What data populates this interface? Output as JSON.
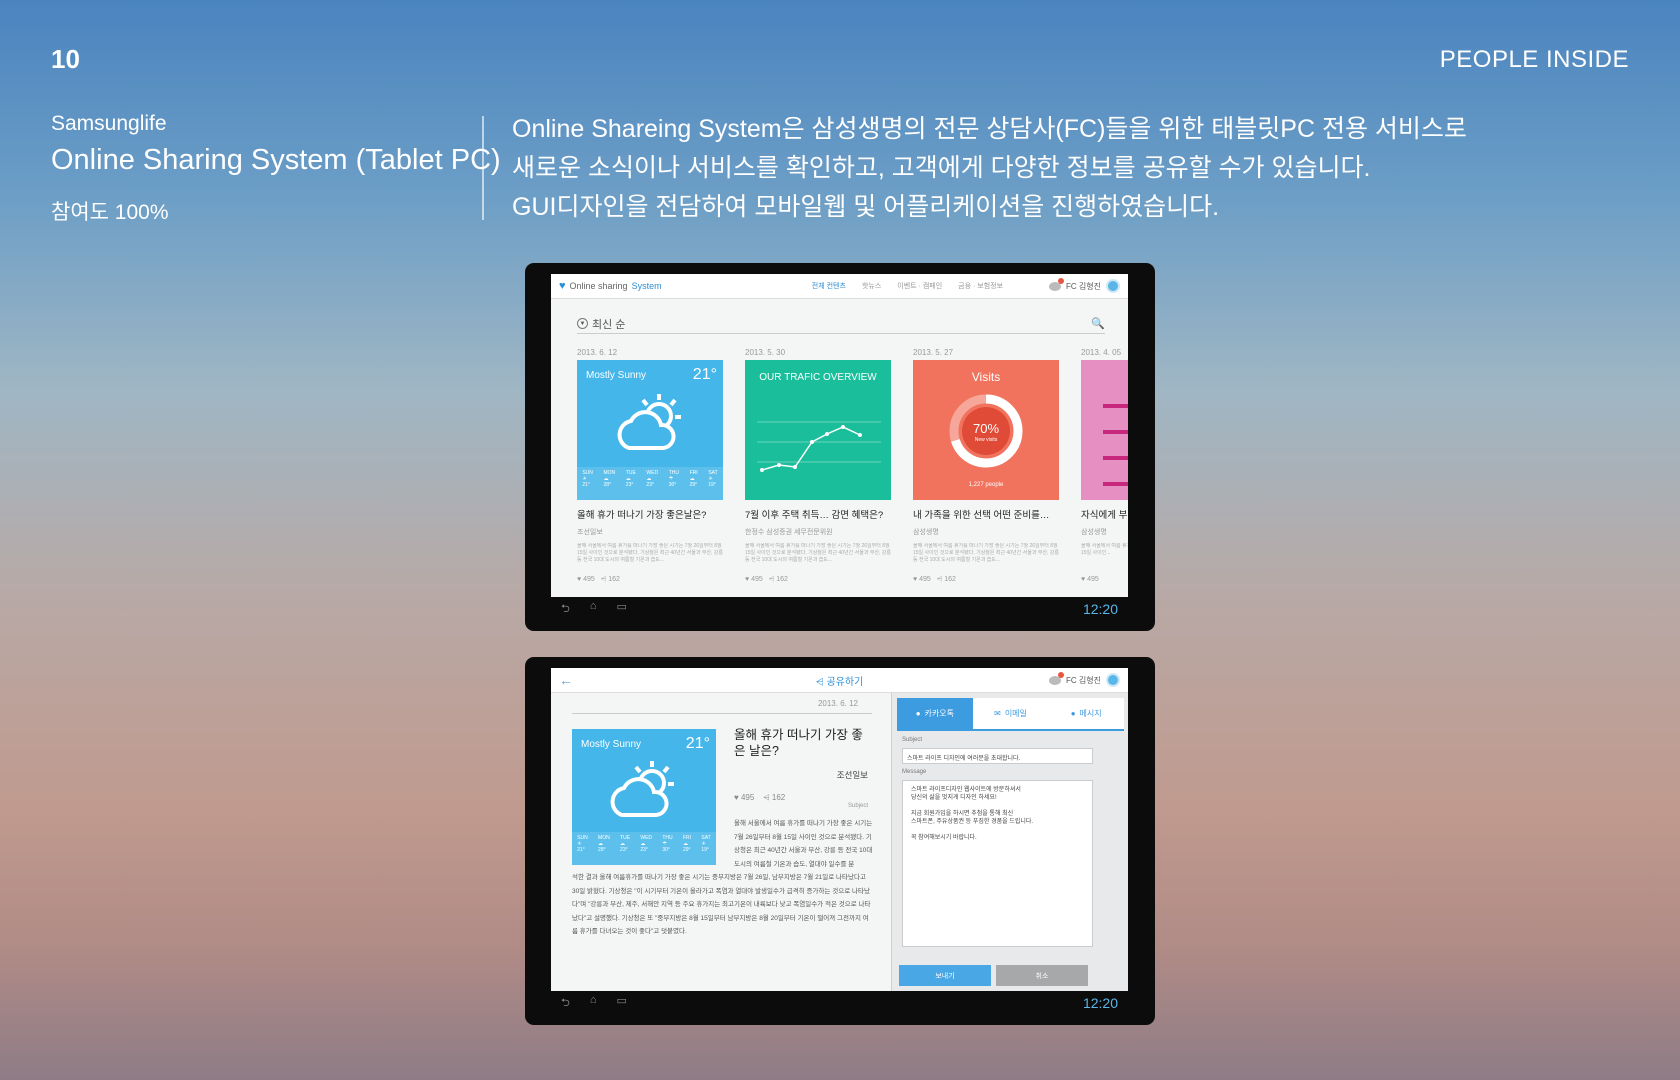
{
  "page_number": "10",
  "brand": "PEOPLE INSIDE",
  "project": {
    "company": "Samsunglife",
    "title": "Online Sharing System (Tablet PC)",
    "participation": "참여도 100%"
  },
  "description": [
    "Online Shareing System은 삼성생명의 전문 상담사(FC)들을 위한 태블릿PC 전용 서비스로",
    "새로운 소식이나 서비스를 확인하고, 고객에게 다양한 정보를 공유할 수가 있습니다.",
    "GUI디자인을 전담하여 모바일웹 및 어플리케이션을 진행하였습니다."
  ],
  "tablet_list": {
    "logo_prefix": "Online sharing ",
    "logo_suffix": "System",
    "tabs": [
      "전체 컨텐츠",
      "핫뉴스",
      "이벤트 · 캠페인",
      "금융 · 보험정보"
    ],
    "user_label": "FC 김형진",
    "notif_count": "3",
    "sort_label": "최신 순",
    "cards": [
      {
        "date": "2013. 6. 12",
        "thumb": "Mostly Sunny",
        "temp": "21°",
        "title": "올해 휴가 떠나기 가장 좋은날은?",
        "source": "조선일보",
        "body": "올해 서울에서 여름 휴가를 떠나기 가장 좋은 시기는 7월 26일부터 8월 15일 사이인 것으로 분석됐다. 기상청은 최근 40년간 서울과 부산, 강릉 등 전국 10대 도시의 여름철 기온과 습도...",
        "likes": "495",
        "shares": "162"
      },
      {
        "date": "2013. 5. 30",
        "thumb": "OUR TRAFIC OVERVIEW",
        "title": "7월 이후 주택 취득… 감면 혜택은?",
        "source": "한정수 삼성증권 세무전문위원",
        "body": "올해 서울에서 여름 휴가를 떠나기 가장 좋은 시기는 7월 26일부터 8월 15일 사이인 것으로 분석됐다. 기상청은 최근 40년간 서울과 부산, 강릉 등 전국 10대 도시의 여름철 기온과 습도...",
        "likes": "495",
        "shares": "162"
      },
      {
        "date": "2013. 5. 27",
        "thumb": "Visits",
        "pct": "70%",
        "pct_sub": "New visits",
        "people": "1,227 people",
        "title": "내 가족을 위한 선택 어떤 준비를…",
        "source": "삼성생명",
        "body": "올해 서울에서 여름 휴가를 떠나기 가장 좋은 시기는 7월 26일부터 8월 15일 사이인 것으로 분석됐다. 기상청은 최근 40년간 서울과 부산, 강릉 등 전국 10대 도시의 여름철 기온과 습도...",
        "likes": "495",
        "shares": "162"
      },
      {
        "date": "2013. 4. 05",
        "thumb": "",
        "title": "자식에게 부",
        "source": "삼성생명",
        "body": "올해 서울에서 여름 휴가를 떠나기 가장 좋은 시기는 7월 26일부터 8월 15일 사이인...",
        "likes": "495",
        "shares": ""
      }
    ],
    "forecast": [
      {
        "day": "SUN",
        "t": "21°"
      },
      {
        "day": "MON",
        "t": "28°"
      },
      {
        "day": "TUE",
        "t": "23°"
      },
      {
        "day": "WED",
        "t": "23°"
      },
      {
        "day": "THU",
        "t": "30°"
      },
      {
        "day": "FRI",
        "t": "29°"
      },
      {
        "day": "SAT",
        "t": "19°"
      }
    ],
    "time": "12:20"
  },
  "tablet_detail": {
    "share_title": "공유하기",
    "user_label": "FC 김형진",
    "notif_count": "3",
    "date": "2013. 6. 12",
    "thumb": "Mostly Sunny",
    "temp": "21°",
    "title": "올해 휴가 떠나기 가장 좋은 날은?",
    "source": "조선일보",
    "likes": "495",
    "shares": "162",
    "subject_tag": "Subject",
    "text1": "올해 서울에서 여름 휴가를 떠나기 가장 좋은 시기는 7월 26일부터 8월 15일 사이인 것으로 분석됐다. 기상청은 최근 40년간 서울과 부산, 강릉 등 전국 10대 도시의 여름철 기온과 습도, 열대야 일수를 분",
    "text2": "석한 결과 올해 여름휴가를 떠나기 가장 좋은 시기는 중부지방은 7월 26일, 남부지방은 7월 21일로 나타났다고 30일 밝혔다. 기상청은 \"이 시기부터 기온이 올라가고 폭염과 열대야 발생일수가 급격히 증가하는 것으로 나타났다\"며 \"강릉과 부산, 제주, 서해안 지역 등 주요 휴가지는 최고기온이 내륙보다 낮고 폭염일수가 적은 것으로 나타났다\"고 설명했다. 기상청은 또 \"중부지방은 8월 15일부터 남부지방은 8월 20일부터 기온이 떨어져 그전까지 여름 휴가를 다녀오는 것이 좋다\"고 덧붙였다.",
    "panel_tabs": [
      "카카오톡",
      "이메일",
      "메시지"
    ],
    "subject_label": "Subject",
    "subject_value": "스마트 라이프 디자인에 여러분을 초대합니다.",
    "message_label": "Message",
    "message_lines": [
      "스마트 라이프디자인 웹사이트에 방문하셔서",
      "당신의 삶을 멋지게 디자인 하세요!",
      "",
      "지금 회원가입을 하시면 추첨을 통해 최신",
      "스마트폰, 주유상품권 등 푸짐한 경품을 드립니다.",
      "",
      "꼭 참여해보시기 바랍니다."
    ],
    "send_label": "보내기",
    "cancel_label": "취소",
    "time": "12:20"
  }
}
